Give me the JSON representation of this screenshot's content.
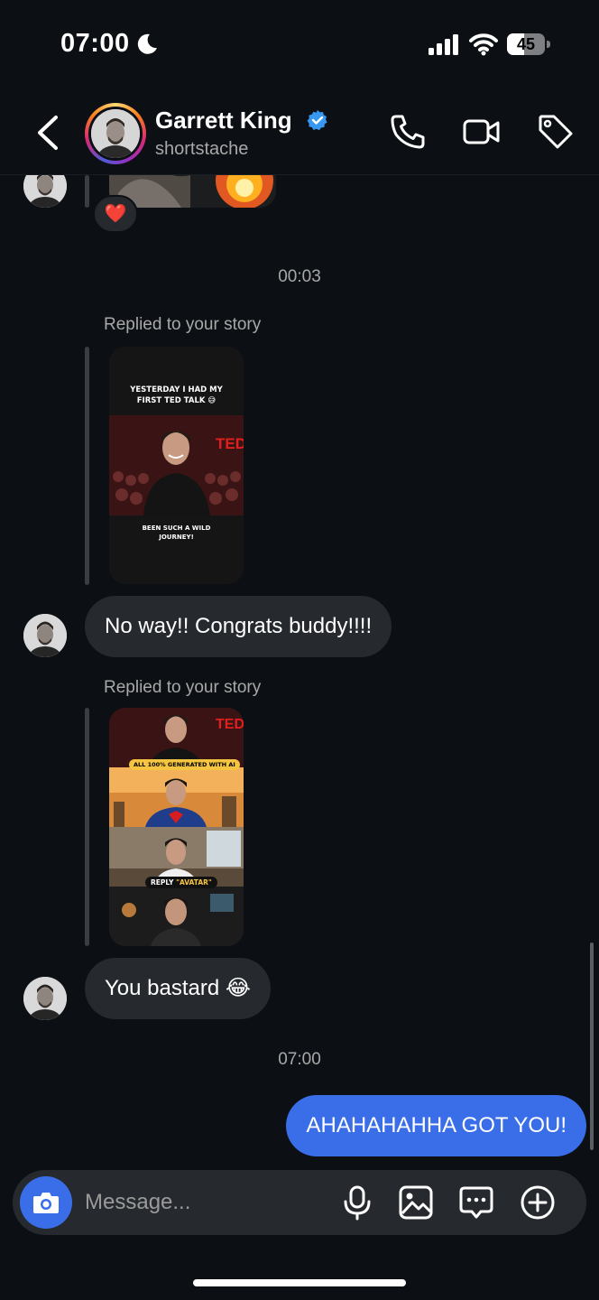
{
  "status_bar": {
    "time": "07:00",
    "battery": "45",
    "battery_level": 0.45
  },
  "header": {
    "name": "Garrett King",
    "handle": "shortstache",
    "verified": true,
    "icons": [
      "back-chevron-icon",
      "phone-icon",
      "video-camera-icon",
      "tag-icon"
    ]
  },
  "messages": {
    "reaction": "❤️",
    "time1": "00:03",
    "reply_label_1": "Replied to your story",
    "story1": {
      "top_text": "YESTERDAY I HAD MY FIRST TED TALK 😅",
      "brand": "TED",
      "bottom_text": "BEEN SUCH A WILD JOURNEY!"
    },
    "msg1": "No way!! Congrats buddy!!!!",
    "reply_label_2": "Replied to your story",
    "story2": {
      "brand": "TED",
      "chip": "ALL 100% GENERATED WITH AI",
      "reply_prefix": "REPLY",
      "reply_keyword": "\"AVATAR\""
    },
    "msg2": "You bastard 😂",
    "time2": "07:00",
    "msg3": "AHAHAHAHHA GOT YOU!"
  },
  "composer": {
    "placeholder": "Message...",
    "icons": [
      "camera-icon",
      "microphone-icon",
      "gallery-icon",
      "chat-dots-icon",
      "plus-circle-icon"
    ]
  },
  "colors": {
    "background": "#0c1014",
    "incoming_bubble": "#262a2f",
    "outgoing_bubble": "#3a6ee8",
    "verified": "#3897f0"
  }
}
